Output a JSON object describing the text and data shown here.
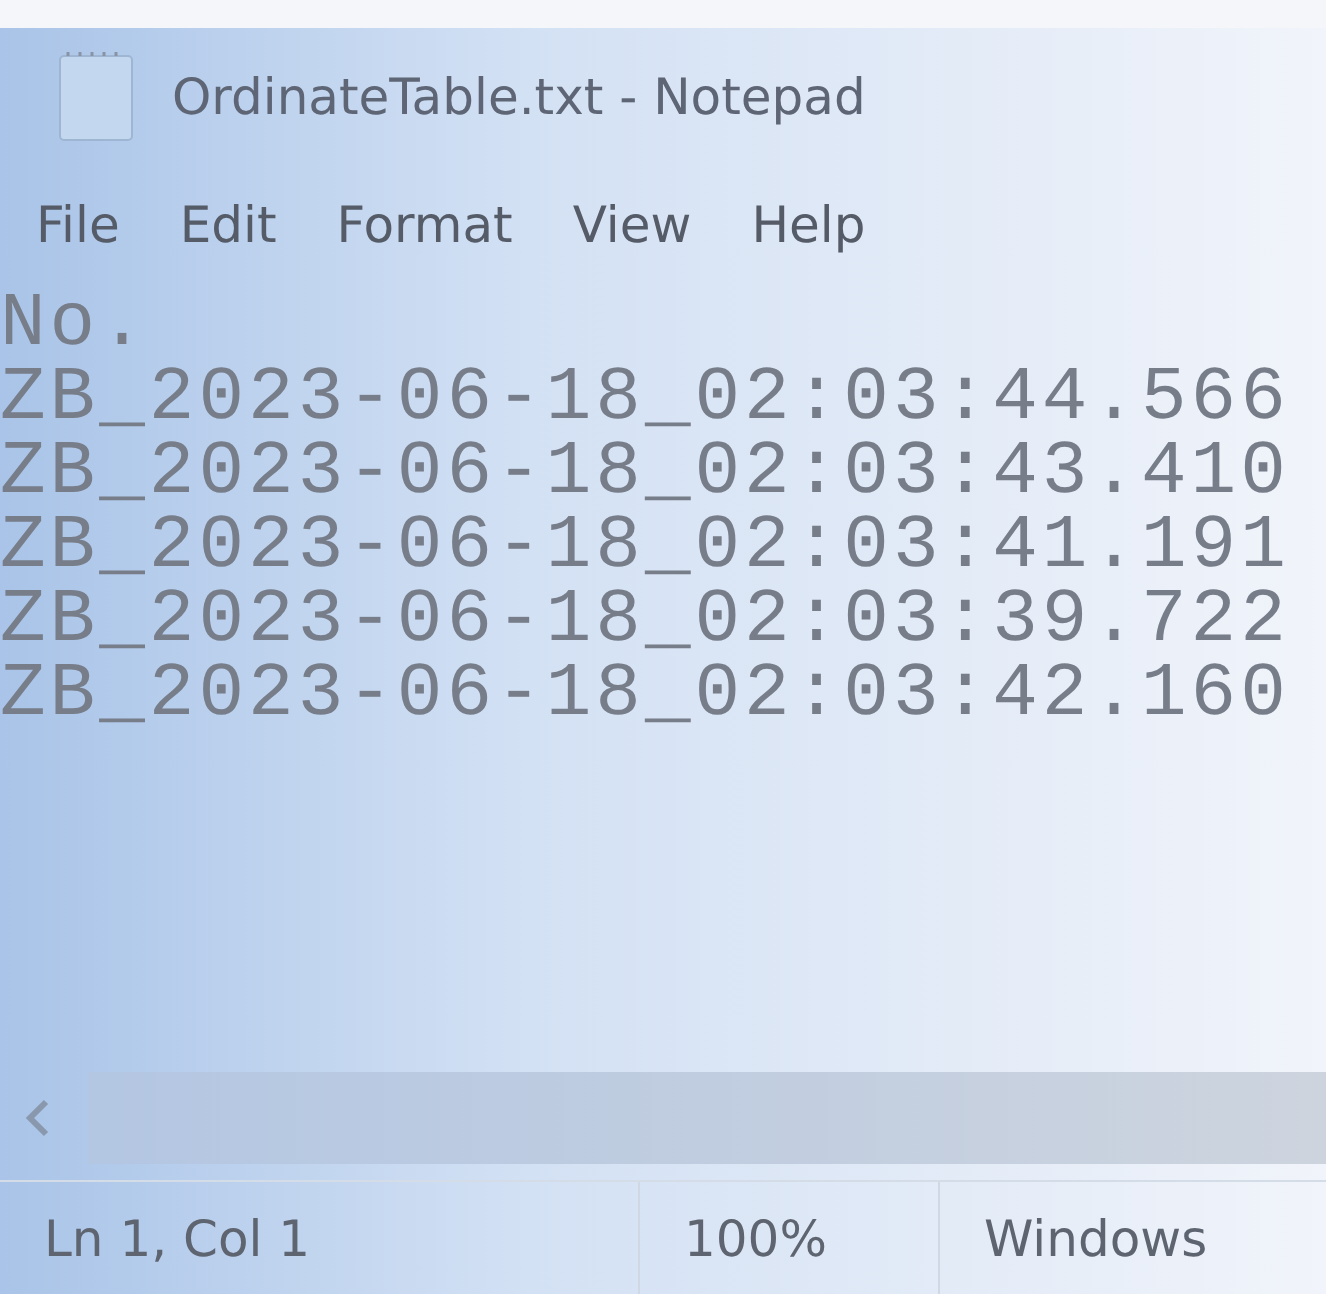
{
  "window": {
    "title": "OrdinateTable.txt - Notepad"
  },
  "menu": [
    "File",
    "Edit",
    "Format",
    "View",
    "Help"
  ],
  "editor": {
    "lines": [
      "No.",
      "ZB_2023-06-18_02:03:44.566",
      "ZB_2023-06-18_02:03:43.410",
      "ZB_2023-06-18_02:03:41.191",
      "ZB_2023-06-18_02:03:39.722",
      "ZB_2023-06-18_02:03:42.160"
    ]
  },
  "status_bar": {
    "position": "Ln 1, Col 1",
    "zoom": "100%",
    "line_ending": "Windows"
  }
}
